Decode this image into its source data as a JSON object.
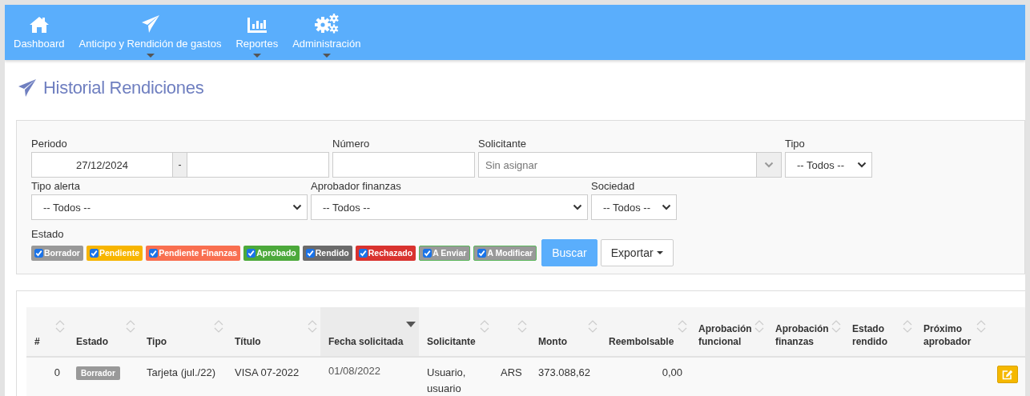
{
  "nav": [
    {
      "label": "Dashboard",
      "has_menu": false
    },
    {
      "label": "Anticipo y Rendición de gastos",
      "has_menu": true
    },
    {
      "label": "Reportes",
      "has_menu": true
    },
    {
      "label": "Administración",
      "has_menu": true
    }
  ],
  "page_title": "Historial Rendiciones",
  "filters": {
    "period": {
      "label": "Periodo",
      "from": "27/12/2024",
      "separator": "-"
    },
    "number": {
      "label": "Número"
    },
    "requester": {
      "label": "Solicitante",
      "placeholder": "Sin asignar"
    },
    "type": {
      "label": "Tipo",
      "value": "-- Todos --"
    },
    "alert_type": {
      "label": "Tipo alerta",
      "value": "-- Todos --"
    },
    "finance_approver": {
      "label": "Aprobador finanzas",
      "value": "-- Todos --"
    },
    "company": {
      "label": "Sociedad",
      "value": "-- Todos --"
    },
    "status_label": "Estado",
    "statuses": [
      {
        "label": "Borrador",
        "checked": true,
        "color": "#999999",
        "kind": "filled"
      },
      {
        "label": "Pendiente",
        "checked": true,
        "color": "#f7b500",
        "kind": "filled"
      },
      {
        "label": "Pendiente Finanzas",
        "checked": true,
        "color": "#f96f50",
        "kind": "filled"
      },
      {
        "label": "Aprobado",
        "checked": true,
        "color": "#4ca93b",
        "kind": "filled"
      },
      {
        "label": "Rendido",
        "checked": true,
        "color": "#6b6b6b",
        "kind": "filled"
      },
      {
        "label": "Rechazado",
        "checked": true,
        "color": "#d9332f",
        "kind": "filled"
      },
      {
        "label": "A Enviar",
        "checked": true,
        "color": "#999999",
        "kind": "outlined"
      },
      {
        "label": "A Modificar",
        "checked": true,
        "color": "#999999",
        "kind": "outlined"
      }
    ],
    "search_button": "Buscar",
    "export_button": "Exportar"
  },
  "table": {
    "columns": [
      {
        "label": "#",
        "sorted": false
      },
      {
        "label": "Estado",
        "sorted": false
      },
      {
        "label": "Tipo",
        "sorted": false
      },
      {
        "label": "Título",
        "sorted": false
      },
      {
        "label": "Fecha solicitada",
        "sorted": true
      },
      {
        "label": "Solicitante",
        "sorted": false
      },
      {
        "sorted": false
      },
      {
        "label": "Monto",
        "sorted": false
      },
      {
        "label": "Reembolsable",
        "sorted": false
      },
      {
        "label": "Aprobación funcional",
        "sorted": false
      },
      {
        "label": "Aprobación finanzas",
        "sorted": false
      },
      {
        "label": "Estado rendido",
        "sorted": false
      },
      {
        "label": "Próximo aprobador",
        "sorted": false
      }
    ],
    "rows": [
      {
        "number": "0",
        "status": {
          "label": "Borrador",
          "color": "#999999"
        },
        "type": "Tarjeta (jul./22)",
        "title": "VISA 07-2022",
        "date": "01/08/2022",
        "requester": "Usuario, usuario",
        "currency": "ARS",
        "amount": "373.088,62",
        "reimbursable": "0,00"
      }
    ]
  }
}
